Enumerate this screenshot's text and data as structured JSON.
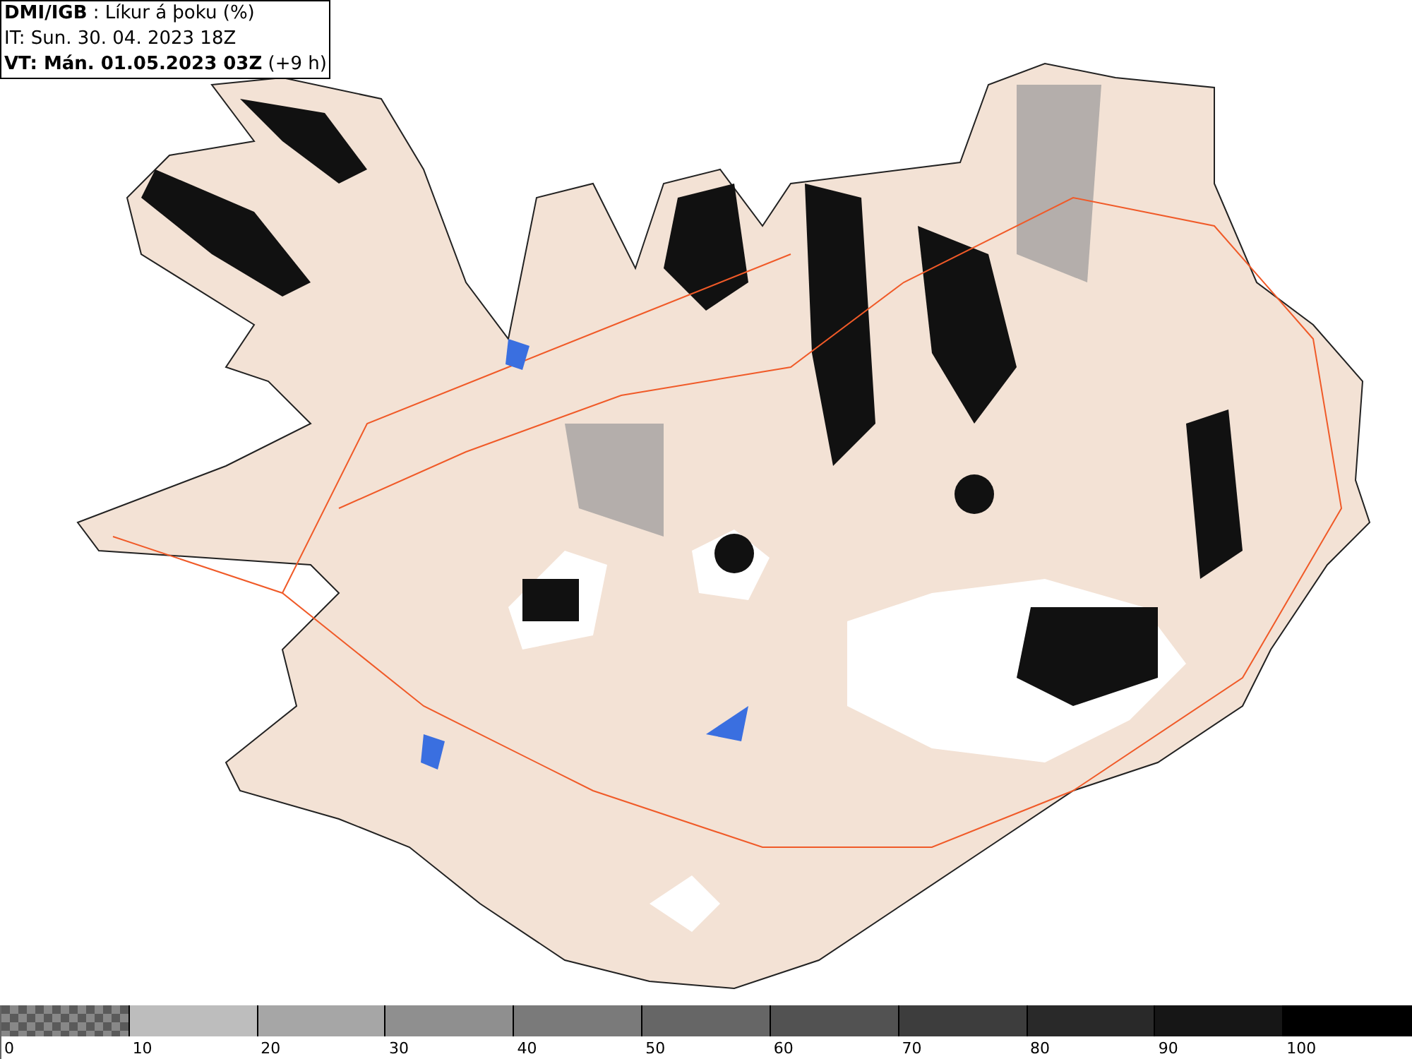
{
  "header": {
    "title": "**DMI/IGB** : Líkur á þoku (%)",
    "issue_time": "IT: Sun. 30. 04. 2023 18Z",
    "valid_time": "**VT: Mán. 01.05.2023 03Z** (+9 h)"
  },
  "legend": [
    {
      "label": "0",
      "kind": "checker",
      "color": "#5a5a5a"
    },
    {
      "label": "10",
      "kind": "solid",
      "color": "#bdbdbd"
    },
    {
      "label": "20",
      "kind": "solid",
      "color": "#a6a6a6"
    },
    {
      "label": "30",
      "kind": "solid",
      "color": "#8f8f8f"
    },
    {
      "label": "40",
      "kind": "solid",
      "color": "#7a7a7a"
    },
    {
      "label": "50",
      "kind": "solid",
      "color": "#666666"
    },
    {
      "label": "60",
      "kind": "solid",
      "color": "#525252"
    },
    {
      "label": "70",
      "kind": "solid",
      "color": "#3d3d3d"
    },
    {
      "label": "80",
      "kind": "solid",
      "color": "#292929"
    },
    {
      "label": "90",
      "kind": "solid",
      "color": "#161616"
    },
    {
      "label": "100",
      "kind": "solid",
      "color": "#000000"
    }
  ]
}
